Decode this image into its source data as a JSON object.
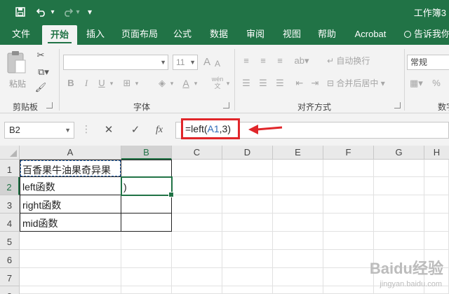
{
  "title_bar": {
    "title": "工作簿3"
  },
  "quick_access": {
    "customize_glyph": "▾"
  },
  "tabs": [
    {
      "label": "文件"
    },
    {
      "label": "开始"
    },
    {
      "label": "插入"
    },
    {
      "label": "页面布局"
    },
    {
      "label": "公式"
    },
    {
      "label": "数据"
    },
    {
      "label": "审阅"
    },
    {
      "label": "视图"
    },
    {
      "label": "帮助"
    },
    {
      "label": "Acrobat"
    },
    {
      "label": "告诉我你"
    }
  ],
  "ribbon": {
    "clipboard": {
      "paste_label": "粘贴",
      "group_label": "剪贴板"
    },
    "font": {
      "font_name": "",
      "font_size": "11",
      "bold": "B",
      "italic": "I",
      "underline": "U",
      "grow_font": "A",
      "shrink_font": "A",
      "font_color_letter": "A",
      "phonetic": "wén",
      "group_label": "字体"
    },
    "alignment": {
      "wrap_text": "自动换行",
      "merge_center": "合并后居中",
      "group_label": "对齐方式"
    },
    "number": {
      "format": "常规",
      "group_label": "数字"
    }
  },
  "formula_bar": {
    "name_box": "B2",
    "cancel_glyph": "✕",
    "enter_glyph": "✓",
    "fx_label": "fx",
    "formula_prefix": "=left(",
    "formula_ref": "A1",
    "formula_suffix": ",3)"
  },
  "sheet": {
    "columns": [
      "A",
      "B",
      "C",
      "D",
      "E",
      "F",
      "G",
      "H"
    ],
    "rows": [
      "1",
      "2",
      "3",
      "4",
      "5",
      "6",
      "7",
      "8"
    ],
    "cells": {
      "A1": "百香果牛油果奇异果",
      "A2": "left函数",
      "A3": "right函数",
      "A4": "mid函数",
      "B2": ")"
    },
    "active_cell": "B2",
    "referenced_cell": "A1"
  },
  "watermark": {
    "text": "Baidu经验",
    "sub": "jingyan.baidu.com"
  },
  "colors": {
    "excel_green": "#217346",
    "annotation_red": "#e0262a",
    "reference_blue": "#2f6bb6"
  }
}
